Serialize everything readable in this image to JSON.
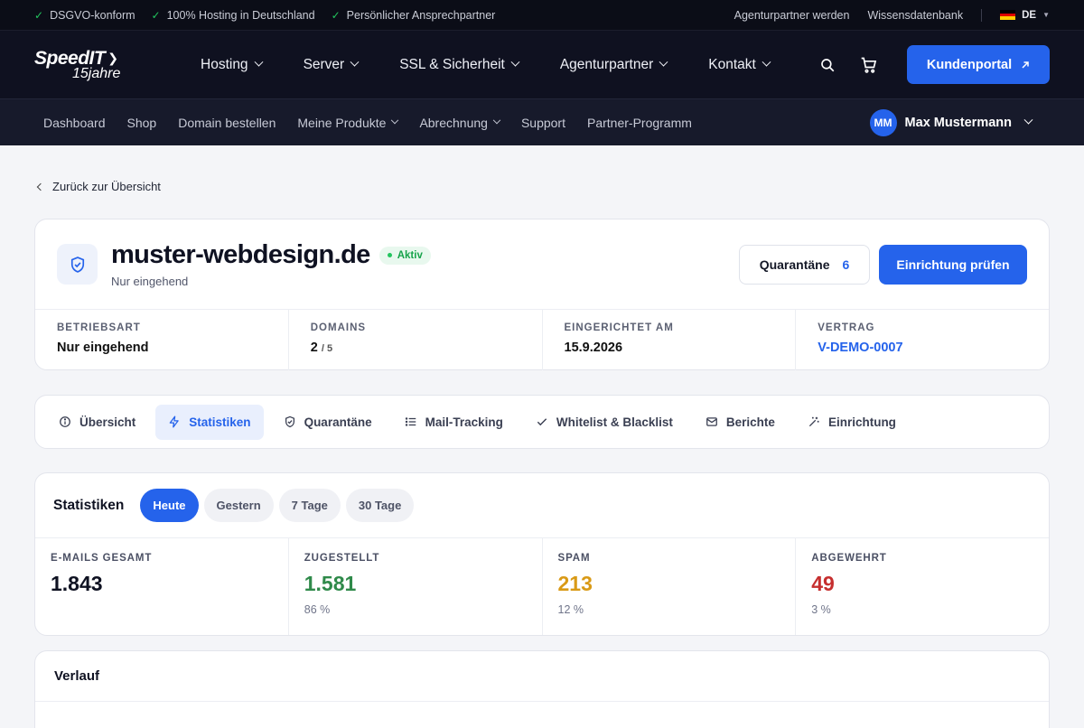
{
  "topbar": {
    "features": [
      "DSGVO-konform",
      "100% Hosting in Deutschland",
      "Persönlicher Ansprechpartner"
    ],
    "links": [
      "Agenturpartner werden",
      "Wissensdatenbank"
    ],
    "language": "DE"
  },
  "logo": {
    "line1": "SpeedIT",
    "line2": "15jahre"
  },
  "mainnav": {
    "items": [
      "Hosting",
      "Server",
      "SSL & Sicherheit",
      "Agenturpartner",
      "Kontakt"
    ],
    "cta": "Kundenportal"
  },
  "subnav": {
    "items": [
      {
        "label": "Dashboard",
        "dropdown": false
      },
      {
        "label": "Shop",
        "dropdown": false
      },
      {
        "label": "Domain bestellen",
        "dropdown": false
      },
      {
        "label": "Meine Produkte",
        "dropdown": true
      },
      {
        "label": "Abrechnung",
        "dropdown": true
      },
      {
        "label": "Support",
        "dropdown": false
      },
      {
        "label": "Partner-Programm",
        "dropdown": false
      }
    ],
    "user": {
      "initials": "MM",
      "name": "Max Mustermann"
    }
  },
  "back_label": "Zurück zur Übersicht",
  "domain": {
    "name": "muster-webdesign.de",
    "status": "Aktiv",
    "subtitle": "Nur eingehend",
    "quarantine_label": "Quarantäne",
    "quarantine_count": "6",
    "check_button": "Einrichtung prüfen"
  },
  "meta": {
    "mode_label": "BETRIEBSART",
    "mode_value": "Nur eingehend",
    "domains_label": "DOMAINS",
    "domains_value": "2",
    "domains_max": "/ 5",
    "setup_label": "EINGERICHTET AM",
    "setup_value": "15.9.2026",
    "contract_label": "VERTRAG",
    "contract_value": "V-DEMO-0007"
  },
  "tabs": [
    {
      "label": "Übersicht",
      "icon": "info-icon"
    },
    {
      "label": "Statistiken",
      "icon": "bolt-icon",
      "active": true
    },
    {
      "label": "Quarantäne",
      "icon": "shield-check-icon"
    },
    {
      "label": "Mail-Tracking",
      "icon": "list-icon"
    },
    {
      "label": "Whitelist & Blacklist",
      "icon": "check-icon"
    },
    {
      "label": "Berichte",
      "icon": "mail-icon"
    },
    {
      "label": "Einrichtung",
      "icon": "wand-icon"
    }
  ],
  "stats": {
    "title": "Statistiken",
    "ranges": [
      "Heute",
      "Gestern",
      "7 Tage",
      "30 Tage"
    ],
    "active_range": "Heute",
    "items": [
      {
        "label": "E-MAILS GESAMT",
        "value": "1.843",
        "pct": "",
        "color": "#0f1222"
      },
      {
        "label": "ZUGESTELLT",
        "value": "1.581",
        "pct": "86 %",
        "color": "#2f8a4a"
      },
      {
        "label": "SPAM",
        "value": "213",
        "pct": "12 %",
        "color": "#d99a16"
      },
      {
        "label": "ABGEWEHRT",
        "value": "49",
        "pct": "3 %",
        "color": "#c62f2f"
      }
    ]
  },
  "verlauf": {
    "title": "Verlauf"
  },
  "colors": {
    "accent": "#2563eb",
    "success": "#16a34a",
    "dark_bg": "#0f1120"
  }
}
